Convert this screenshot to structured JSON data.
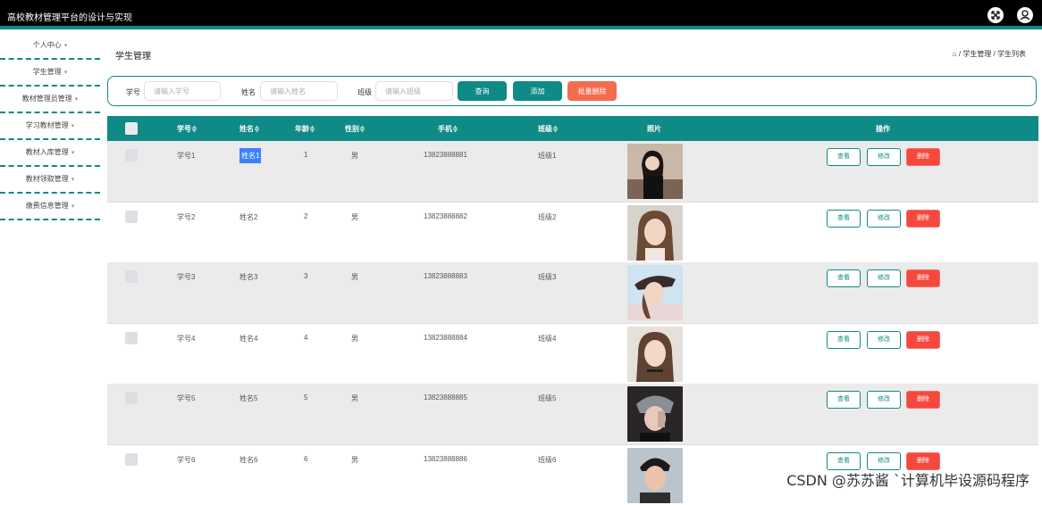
{
  "app": {
    "title": "高校教材管理平台的设计与实现"
  },
  "sidebar": {
    "items": [
      {
        "label": "个人中心"
      },
      {
        "label": "学生管理"
      },
      {
        "label": "教材管理员管理"
      },
      {
        "label": "学习教材管理"
      },
      {
        "label": "教材入库管理"
      },
      {
        "label": "教材领取管理"
      },
      {
        "label": "缴费信息管理"
      }
    ]
  },
  "page": {
    "title": "学生管理",
    "breadcrumb": "/ 学生管理 / 学生列表"
  },
  "search": {
    "id_label": "学号",
    "id_placeholder": "请输入学号",
    "name_label": "姓名",
    "name_placeholder": "请输入姓名",
    "class_label": "班级",
    "class_placeholder": "请输入班级",
    "query_btn": "查询",
    "add_btn": "添加",
    "batch_delete_btn": "批量删除"
  },
  "table": {
    "headers": [
      "学号≑",
      "姓名≑",
      "年龄≑",
      "性别≑",
      "手机≑",
      "班级≑",
      "照片",
      "操作"
    ],
    "rows": [
      {
        "sid": "学号1",
        "name": "姓名1",
        "age": "1",
        "gender": "男",
        "phone": "13823888881",
        "cls": "班级1"
      },
      {
        "sid": "学号2",
        "name": "姓名2",
        "age": "2",
        "gender": "男",
        "phone": "13823888882",
        "cls": "班级2"
      },
      {
        "sid": "学号3",
        "name": "姓名3",
        "age": "3",
        "gender": "男",
        "phone": "13823888883",
        "cls": "班级3"
      },
      {
        "sid": "学号4",
        "name": "姓名4",
        "age": "4",
        "gender": "男",
        "phone": "13823888884",
        "cls": "班级4"
      },
      {
        "sid": "学号5",
        "name": "姓名5",
        "age": "5",
        "gender": "男",
        "phone": "13823888885",
        "cls": "班级5"
      },
      {
        "sid": "学号6",
        "name": "姓名6",
        "age": "6",
        "gender": "男",
        "phone": "13823888886",
        "cls": "班级6"
      }
    ],
    "actions": {
      "view": "查看",
      "edit": "修改",
      "delete": "删除"
    }
  },
  "watermark": "CSDN @苏苏酱  `计算机毕设源码程序",
  "colors": {
    "accent": "#0f8a87",
    "danger": "#f5493d",
    "topbar": "#000000"
  }
}
